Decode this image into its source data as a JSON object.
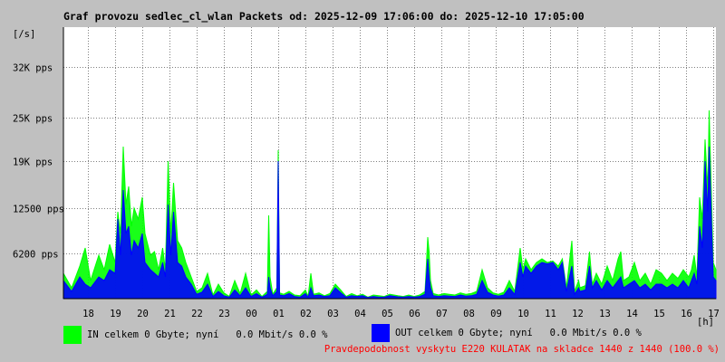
{
  "title": "Graf provozu sedlec_cl_wlan Packets od: 2025-12-09 17:06:00 do: 2025-12-10 17:05:00",
  "colors": {
    "background": "#c0c0c0",
    "plot": "#ffffff",
    "grid": "#808080",
    "in": "#00ff00",
    "out": "#0000ff",
    "warning": "#ff0000"
  },
  "chart_data": {
    "type": "area",
    "ylabel": "[/s]",
    "xlabel": "[h]",
    "y_ticks": [
      "6200 pps",
      "12500 pps",
      "19K pps",
      "25K pps",
      "32K pps"
    ],
    "y_tick_values": [
      6200,
      12500,
      19000,
      25000,
      32000
    ],
    "ylim": [
      0,
      37500
    ],
    "x_ticks": [
      "18",
      "19",
      "20",
      "21",
      "22",
      "23",
      "00",
      "01",
      "02",
      "03",
      "04",
      "05",
      "06",
      "07",
      "08",
      "09",
      "10",
      "11",
      "12",
      "13",
      "14",
      "15",
      "16",
      "17"
    ],
    "x_tick_hours": [
      0.9,
      1.9,
      2.9,
      3.9,
      4.9,
      5.9,
      6.9,
      7.9,
      8.9,
      9.9,
      10.9,
      11.9,
      12.9,
      13.9,
      14.9,
      15.9,
      16.9,
      17.9,
      18.9,
      19.9,
      20.9,
      21.9,
      22.9,
      23.9
    ],
    "xlim_hours": [
      0,
      24
    ],
    "grid": true,
    "series": [
      {
        "name": "IN",
        "color": "#00ff00",
        "points": [
          [
            0.0,
            3500
          ],
          [
            0.3,
            1500
          ],
          [
            0.6,
            4500
          ],
          [
            0.8,
            7000
          ],
          [
            1.0,
            2500
          ],
          [
            1.3,
            6000
          ],
          [
            1.5,
            4000
          ],
          [
            1.7,
            7500
          ],
          [
            1.9,
            5000
          ],
          [
            2.0,
            12000
          ],
          [
            2.1,
            9000
          ],
          [
            2.2,
            21000
          ],
          [
            2.3,
            13000
          ],
          [
            2.4,
            15500
          ],
          [
            2.5,
            10000
          ],
          [
            2.6,
            12500
          ],
          [
            2.75,
            11000
          ],
          [
            2.9,
            14000
          ],
          [
            3.0,
            9000
          ],
          [
            3.2,
            6000
          ],
          [
            3.35,
            6500
          ],
          [
            3.5,
            4000
          ],
          [
            3.65,
            7000
          ],
          [
            3.75,
            4000
          ],
          [
            3.85,
            19000
          ],
          [
            3.95,
            9000
          ],
          [
            4.05,
            16000
          ],
          [
            4.2,
            8000
          ],
          [
            4.35,
            7000
          ],
          [
            4.5,
            5000
          ],
          [
            4.7,
            3000
          ],
          [
            4.9,
            1000
          ],
          [
            5.1,
            1500
          ],
          [
            5.3,
            3500
          ],
          [
            5.5,
            500
          ],
          [
            5.7,
            2000
          ],
          [
            5.9,
            800
          ],
          [
            6.1,
            300
          ],
          [
            6.3,
            2500
          ],
          [
            6.5,
            700
          ],
          [
            6.7,
            3500
          ],
          [
            6.9,
            500
          ],
          [
            7.1,
            1200
          ],
          [
            7.3,
            300
          ],
          [
            7.5,
            1000
          ],
          [
            7.55,
            11500
          ],
          [
            7.6,
            3000
          ],
          [
            7.7,
            600
          ],
          [
            7.85,
            1500
          ],
          [
            7.9,
            20500
          ],
          [
            7.95,
            800
          ],
          [
            8.1,
            600
          ],
          [
            8.3,
            1000
          ],
          [
            8.5,
            500
          ],
          [
            8.7,
            400
          ],
          [
            8.9,
            1200
          ],
          [
            9.0,
            300
          ],
          [
            9.1,
            3500
          ],
          [
            9.2,
            600
          ],
          [
            9.4,
            800
          ],
          [
            9.6,
            400
          ],
          [
            9.8,
            700
          ],
          [
            10.0,
            2000
          ],
          [
            10.2,
            1200
          ],
          [
            10.4,
            300
          ],
          [
            10.6,
            700
          ],
          [
            10.8,
            400
          ],
          [
            11.0,
            600
          ],
          [
            11.2,
            200
          ],
          [
            11.4,
            500
          ],
          [
            11.6,
            400
          ],
          [
            11.8,
            300
          ],
          [
            12.0,
            600
          ],
          [
            12.3,
            400
          ],
          [
            12.5,
            300
          ],
          [
            12.7,
            500
          ],
          [
            12.9,
            300
          ],
          [
            13.1,
            500
          ],
          [
            13.3,
            1000
          ],
          [
            13.4,
            8500
          ],
          [
            13.45,
            6500
          ],
          [
            13.5,
            2500
          ],
          [
            13.6,
            700
          ],
          [
            13.8,
            500
          ],
          [
            14.0,
            700
          ],
          [
            14.2,
            600
          ],
          [
            14.4,
            500
          ],
          [
            14.6,
            800
          ],
          [
            14.8,
            600
          ],
          [
            15.0,
            700
          ],
          [
            15.2,
            1000
          ],
          [
            15.4,
            4000
          ],
          [
            15.6,
            1500
          ],
          [
            15.8,
            800
          ],
          [
            16.0,
            600
          ],
          [
            16.2,
            900
          ],
          [
            16.4,
            2500
          ],
          [
            16.6,
            1000
          ],
          [
            16.8,
            7000
          ],
          [
            16.9,
            4000
          ],
          [
            17.0,
            5500
          ],
          [
            17.2,
            4000
          ],
          [
            17.4,
            5000
          ],
          [
            17.6,
            5500
          ],
          [
            17.8,
            5000
          ],
          [
            18.0,
            5200
          ],
          [
            18.2,
            4500
          ],
          [
            18.35,
            5500
          ],
          [
            18.5,
            1500
          ],
          [
            18.7,
            8000
          ],
          [
            18.8,
            1000
          ],
          [
            18.95,
            2500
          ],
          [
            19.0,
            1500
          ],
          [
            19.2,
            1800
          ],
          [
            19.35,
            6500
          ],
          [
            19.45,
            2000
          ],
          [
            19.6,
            3500
          ],
          [
            19.8,
            2000
          ],
          [
            20.0,
            4500
          ],
          [
            20.2,
            2500
          ],
          [
            20.4,
            5500
          ],
          [
            20.5,
            6500
          ],
          [
            20.6,
            2500
          ],
          [
            20.8,
            3000
          ],
          [
            21.0,
            5000
          ],
          [
            21.2,
            2500
          ],
          [
            21.4,
            3500
          ],
          [
            21.6,
            2000
          ],
          [
            21.8,
            4000
          ],
          [
            22.0,
            3500
          ],
          [
            22.2,
            2500
          ],
          [
            22.4,
            3500
          ],
          [
            22.6,
            2800
          ],
          [
            22.8,
            4000
          ],
          [
            23.0,
            3000
          ],
          [
            23.1,
            4000
          ],
          [
            23.2,
            6000
          ],
          [
            23.3,
            3000
          ],
          [
            23.4,
            14000
          ],
          [
            23.5,
            11000
          ],
          [
            23.6,
            22000
          ],
          [
            23.7,
            15000
          ],
          [
            23.75,
            26000
          ],
          [
            23.8,
            19000
          ],
          [
            23.9,
            5000
          ],
          [
            24.0,
            4000
          ]
        ]
      },
      {
        "name": "OUT",
        "color": "#0000ff",
        "points": [
          [
            0.0,
            2500
          ],
          [
            0.3,
            1000
          ],
          [
            0.6,
            3000
          ],
          [
            0.8,
            2000
          ],
          [
            1.0,
            1500
          ],
          [
            1.3,
            3000
          ],
          [
            1.5,
            2500
          ],
          [
            1.7,
            4000
          ],
          [
            1.9,
            3500
          ],
          [
            2.0,
            11000
          ],
          [
            2.1,
            6000
          ],
          [
            2.2,
            15000
          ],
          [
            2.3,
            9000
          ],
          [
            2.4,
            10000
          ],
          [
            2.5,
            6000
          ],
          [
            2.6,
            8000
          ],
          [
            2.75,
            7000
          ],
          [
            2.9,
            9000
          ],
          [
            3.0,
            5000
          ],
          [
            3.2,
            4000
          ],
          [
            3.35,
            3500
          ],
          [
            3.5,
            3000
          ],
          [
            3.65,
            5000
          ],
          [
            3.75,
            3000
          ],
          [
            3.85,
            13000
          ],
          [
            3.95,
            6000
          ],
          [
            4.05,
            12000
          ],
          [
            4.2,
            5000
          ],
          [
            4.35,
            4500
          ],
          [
            4.5,
            3000
          ],
          [
            4.7,
            2000
          ],
          [
            4.9,
            600
          ],
          [
            5.1,
            900
          ],
          [
            5.3,
            2000
          ],
          [
            5.5,
            300
          ],
          [
            5.7,
            1000
          ],
          [
            5.9,
            400
          ],
          [
            6.1,
            200
          ],
          [
            6.3,
            1200
          ],
          [
            6.5,
            400
          ],
          [
            6.7,
            1500
          ],
          [
            6.9,
            300
          ],
          [
            7.1,
            700
          ],
          [
            7.3,
            200
          ],
          [
            7.5,
            600
          ],
          [
            7.55,
            3000
          ],
          [
            7.6,
            1500
          ],
          [
            7.7,
            400
          ],
          [
            7.85,
            1000
          ],
          [
            7.9,
            19000
          ],
          [
            7.95,
            500
          ],
          [
            8.1,
            400
          ],
          [
            8.3,
            700
          ],
          [
            8.5,
            300
          ],
          [
            8.7,
            200
          ],
          [
            8.9,
            700
          ],
          [
            9.0,
            200
          ],
          [
            9.1,
            1500
          ],
          [
            9.2,
            400
          ],
          [
            9.4,
            500
          ],
          [
            9.6,
            300
          ],
          [
            9.8,
            400
          ],
          [
            10.0,
            1500
          ],
          [
            10.2,
            800
          ],
          [
            10.4,
            200
          ],
          [
            10.6,
            400
          ],
          [
            10.8,
            300
          ],
          [
            11.0,
            400
          ],
          [
            11.2,
            150
          ],
          [
            11.4,
            300
          ],
          [
            11.6,
            200
          ],
          [
            11.8,
            200
          ],
          [
            12.0,
            400
          ],
          [
            12.3,
            250
          ],
          [
            12.5,
            200
          ],
          [
            12.7,
            300
          ],
          [
            12.9,
            200
          ],
          [
            13.1,
            300
          ],
          [
            13.3,
            600
          ],
          [
            13.4,
            5500
          ],
          [
            13.45,
            3000
          ],
          [
            13.5,
            1500
          ],
          [
            13.6,
            400
          ],
          [
            13.8,
            300
          ],
          [
            14.0,
            400
          ],
          [
            14.2,
            350
          ],
          [
            14.4,
            300
          ],
          [
            14.6,
            500
          ],
          [
            14.8,
            350
          ],
          [
            15.0,
            400
          ],
          [
            15.2,
            600
          ],
          [
            15.4,
            2500
          ],
          [
            15.6,
            900
          ],
          [
            15.8,
            500
          ],
          [
            16.0,
            350
          ],
          [
            16.2,
            500
          ],
          [
            16.4,
            1500
          ],
          [
            16.6,
            600
          ],
          [
            16.8,
            5000
          ],
          [
            16.9,
            3000
          ],
          [
            17.0,
            4500
          ],
          [
            17.2,
            3500
          ],
          [
            17.4,
            4500
          ],
          [
            17.6,
            5000
          ],
          [
            17.8,
            4800
          ],
          [
            18.0,
            5000
          ],
          [
            18.2,
            4000
          ],
          [
            18.35,
            5000
          ],
          [
            18.5,
            1000
          ],
          [
            18.7,
            4500
          ],
          [
            18.8,
            600
          ],
          [
            18.95,
            1500
          ],
          [
            19.0,
            1000
          ],
          [
            19.2,
            1200
          ],
          [
            19.35,
            4500
          ],
          [
            19.45,
            1500
          ],
          [
            19.6,
            2500
          ],
          [
            19.8,
            1200
          ],
          [
            20.0,
            2500
          ],
          [
            20.2,
            1500
          ],
          [
            20.4,
            2500
          ],
          [
            20.5,
            3000
          ],
          [
            20.6,
            1500
          ],
          [
            20.8,
            2000
          ],
          [
            21.0,
            2500
          ],
          [
            21.2,
            1500
          ],
          [
            21.4,
            2000
          ],
          [
            21.6,
            1200
          ],
          [
            21.8,
            2000
          ],
          [
            22.0,
            2000
          ],
          [
            22.2,
            1500
          ],
          [
            22.4,
            2000
          ],
          [
            22.6,
            1500
          ],
          [
            22.8,
            2500
          ],
          [
            23.0,
            1500
          ],
          [
            23.1,
            2500
          ],
          [
            23.2,
            3500
          ],
          [
            23.3,
            2000
          ],
          [
            23.4,
            10000
          ],
          [
            23.5,
            7000
          ],
          [
            23.6,
            19000
          ],
          [
            23.7,
            12000
          ],
          [
            23.75,
            21000
          ],
          [
            23.8,
            15000
          ],
          [
            23.9,
            3000
          ],
          [
            24.0,
            2500
          ]
        ]
      }
    ]
  },
  "legend": {
    "in_text": "IN celkem 0 Gbyte; nyní   0.0 Mbit/s 0.0 %",
    "out_text": "OUT celkem 0 Gbyte; nyní   0.0 Mbit/s 0.0 %"
  },
  "footer": "Pravdepodobnost vyskytu E220 KULATAK na skladce 1440 z 1440 (100.0 %)"
}
